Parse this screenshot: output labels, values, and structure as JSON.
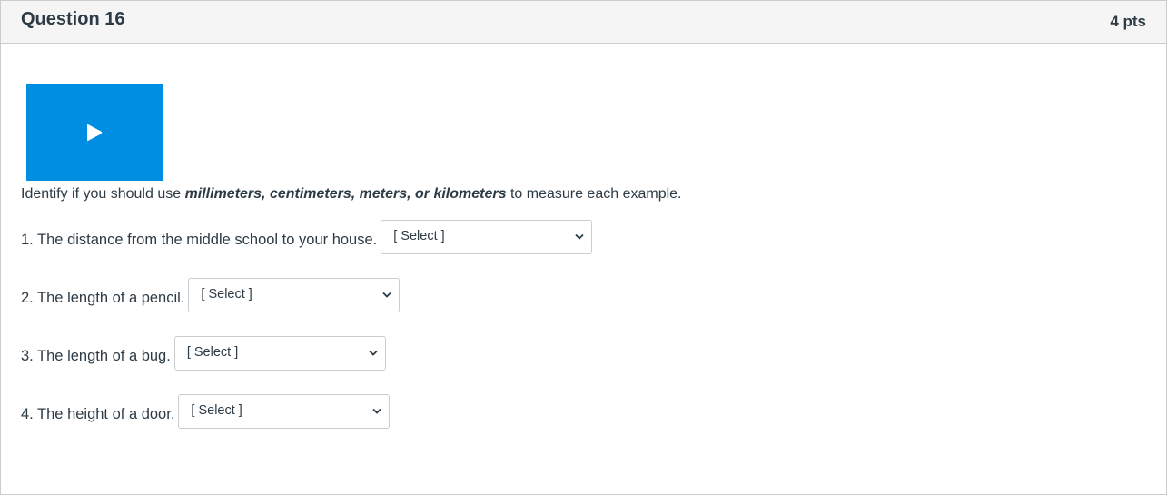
{
  "question": {
    "title": "Question 16",
    "points": "4 pts"
  },
  "media": {
    "icon": "play-icon",
    "color": "#008ee2"
  },
  "instructions": {
    "prefix": "Identify if you should use ",
    "units": "millimeters, centimeters, meters, or kilometers",
    "suffix": " to measure each example."
  },
  "items": [
    {
      "label": "1. The distance from the middle school to your house.",
      "selected": "[ Select ]"
    },
    {
      "label": "2. The length of a pencil.",
      "selected": "[ Select ]"
    },
    {
      "label": "3. The length of a bug.",
      "selected": "[ Select ]"
    },
    {
      "label": "4. The height of a door.",
      "selected": "[ Select ]"
    }
  ]
}
